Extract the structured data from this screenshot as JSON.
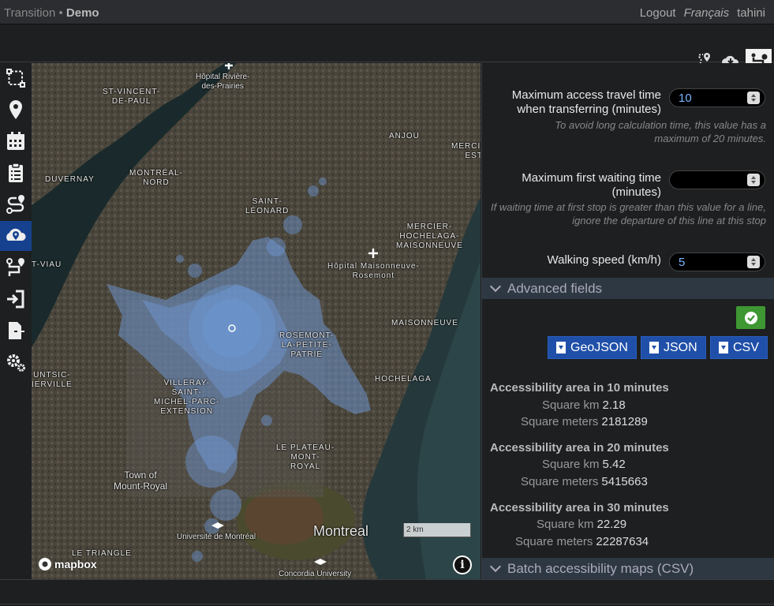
{
  "header": {
    "app_name": "Transition",
    "separator": "•",
    "project": "Demo",
    "logout": "Logout",
    "language": "Français",
    "username": "tahini"
  },
  "toolbar": {
    "buttons": [
      "routing-compare-icon",
      "cloud-download-icon",
      "accessibility-route-icon"
    ]
  },
  "nav": {
    "items": [
      {
        "icon": "network-nodes-icon"
      },
      {
        "icon": "map-marker-icon"
      },
      {
        "icon": "calendar-icon"
      },
      {
        "icon": "clipboard-list-icon"
      },
      {
        "icon": "route-icon"
      },
      {
        "icon": "accessibility-map-icon",
        "active": true
      },
      {
        "icon": "od-route-icon"
      },
      {
        "icon": "import-icon"
      },
      {
        "icon": "export-file-icon"
      },
      {
        "icon": "settings-gears-icon"
      }
    ]
  },
  "map": {
    "labels": {
      "st_vincent": "ST-VINCENT-\nDE-PAUL",
      "anjou": "ANJOU",
      "mercier_e": "MERCIER-\nEST",
      "duvernay": "DUVERNAY",
      "montreal_nord": "MONTRÉAL-\nNORD",
      "saint_leonard": "SAINT-\nLÉONARD",
      "mercier_hochelaga": "MERCIER-\nHOCHELAGA-\nMAISONNEUVE",
      "viau": "T-VIAU",
      "rosemont": "ROSEMONT-\nLA-PETITE-\nPATRIE",
      "maisonneuve": "MAISONNEUVE",
      "hochelaga": "HOCHELAGA",
      "untsic": "UNTSIC-\nIERVILLE",
      "villeray": "VILLERAY-\nSAINT-\nMICHEL-PARC-\nEXTENSION",
      "plateau": "LE PLATEAU-\nMONT-\nROYAL",
      "town_mr": "Town of\nMount-Royal",
      "montreal": "Montreal",
      "udem": "Université de Montréal",
      "letriangle": "LE TRIANGLE",
      "concordia": "Concordia University",
      "hopital_rdp": "Hôpital Rivière-\ndes-Prairies",
      "hopital_mr": "Hôpital Maisonneuve-\nRosemont"
    },
    "scale": "2 km",
    "attribution_logo": "mapbox",
    "info": "i"
  },
  "form": {
    "max_access_label": "Maximum access travel time when transferring (minutes)",
    "max_access_value": "10",
    "max_access_help": "To avoid long calculation time, this value has a maximum of 20 minutes.",
    "first_wait_label": "Maximum first waiting time (minutes)",
    "first_wait_value": "",
    "first_wait_help": "If waiting time at first stop is greater than this value for a line, ignore the departure of this line at this stop",
    "walk_label": "Walking speed (km/h)",
    "walk_value": "5",
    "advanced_label": "Advanced fields",
    "geojson": "GeoJSON",
    "json": "JSON",
    "csv": "CSV",
    "batch_label": "Batch accessibility maps (CSV)"
  },
  "results": [
    {
      "title": "Accessibility area in 10 minutes",
      "km_label": "Square km",
      "km": "2.18",
      "m_label": "Square meters",
      "m": "2181289"
    },
    {
      "title": "Accessibility area in 20 minutes",
      "km_label": "Square km",
      "km": "5.42",
      "m_label": "Square meters",
      "m": "5415663"
    },
    {
      "title": "Accessibility area in 30 minutes",
      "km_label": "Square km",
      "km": "22.29",
      "m_label": "Square meters",
      "m": "22287634"
    }
  ],
  "colors": {
    "active_nav": "#16418f",
    "accessibility_polygon": "#6f9ad8",
    "confirm": "#3e9732",
    "download": "#1f4fa8"
  }
}
